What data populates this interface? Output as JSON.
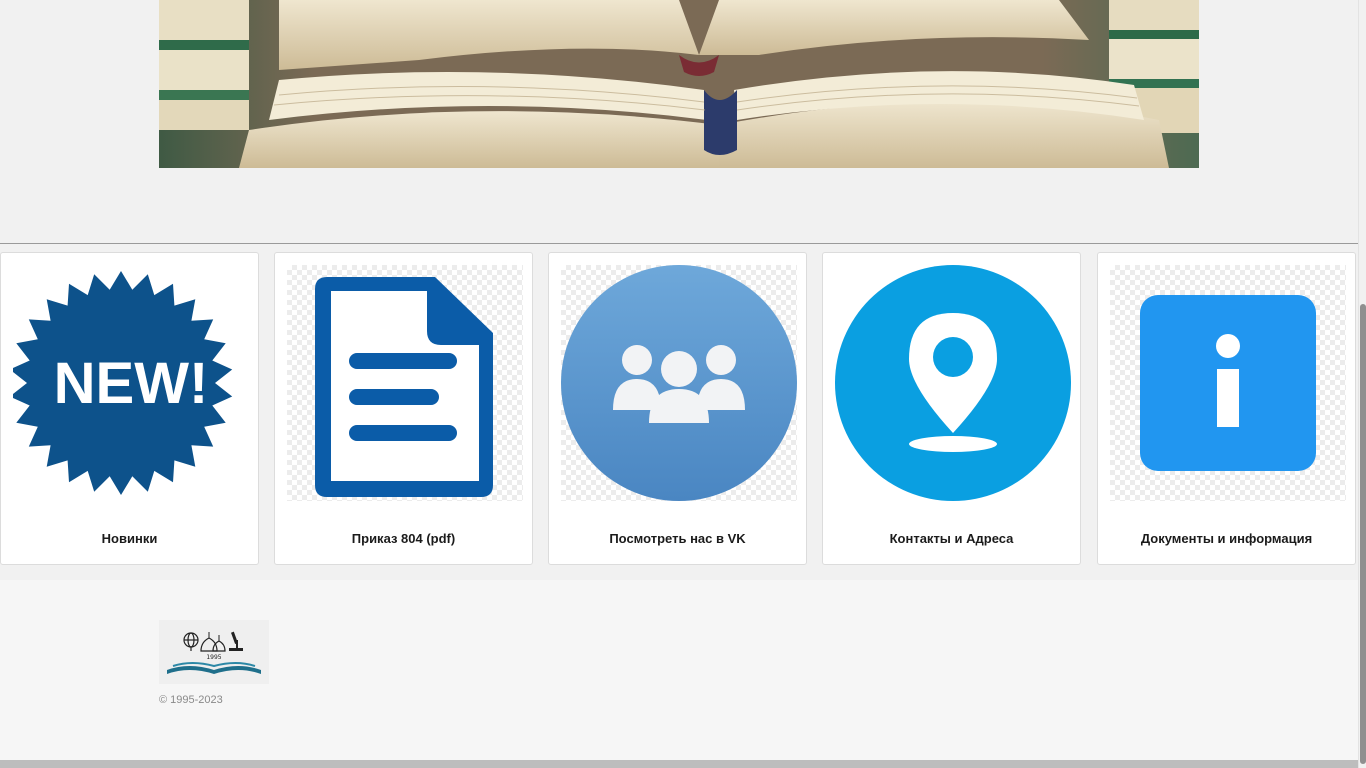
{
  "cards": [
    {
      "label": "Новинки",
      "icon": "new-starburst-icon",
      "color": "#0d528b",
      "badge_text": "NEW!"
    },
    {
      "label": "Приказ 804 (pdf)",
      "icon": "document-icon",
      "color": "#0b5ca8"
    },
    {
      "label": "Посмотреть нас в VK",
      "icon": "group-users-icon",
      "color": "#5b97cf"
    },
    {
      "label": "Контакты и Адреса",
      "icon": "location-pin-icon",
      "color": "#0a9fe1"
    },
    {
      "label": "Документы и информация",
      "icon": "info-icon",
      "color": "#2196f0"
    }
  ],
  "footer": {
    "logo_year": "1995",
    "copyright": "© 1995-2023"
  }
}
